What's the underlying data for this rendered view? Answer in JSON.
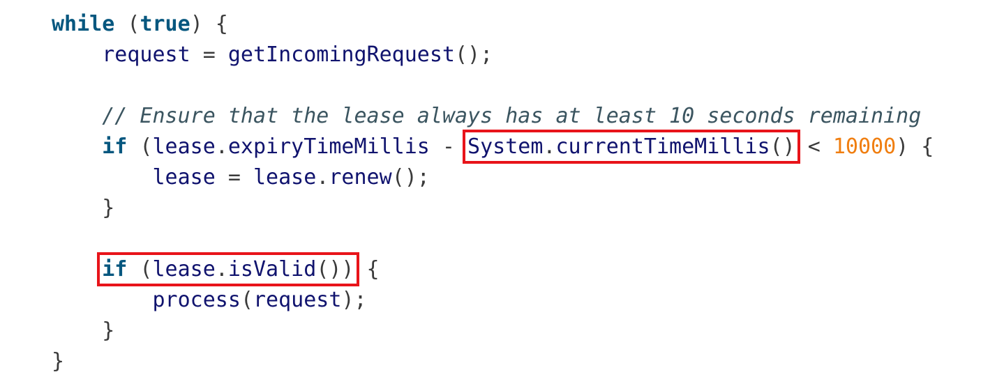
{
  "code": {
    "line1": {
      "kw_while": "while",
      "open_paren": " (",
      "kw_true": "true",
      "close": ") {"
    },
    "line2": {
      "indent": "    ",
      "var": "request",
      "eq": " = ",
      "call": "getIncomingRequest",
      "end": "();"
    },
    "line3": {},
    "line4": {
      "indent": "    ",
      "comment": "// Ensure that the lease always has at least 10 seconds remaining"
    },
    "line5": {
      "indent": "    ",
      "kw_if": "if",
      "paren": " (",
      "obj": "lease",
      "dot": ".",
      "field": "expiryTimeMillis",
      "minus": " - ",
      "hl_class": "System",
      "hl_dot": ".",
      "hl_method": "currentTimeMillis",
      "hl_parens": "()",
      "lt": " < ",
      "number": "10000",
      "close": ") {"
    },
    "line6": {
      "indent": "        ",
      "var": "lease",
      "eq": " = ",
      "obj": "lease",
      "dot": ".",
      "method": "renew",
      "end": "();"
    },
    "line7": {
      "indent": "    ",
      "brace": "}"
    },
    "line8": {},
    "line9": {
      "indent": "    ",
      "kw_if": "if",
      "paren": " (",
      "obj": "lease",
      "dot": ".",
      "method": "isValid",
      "parens": "())",
      "brace": " {"
    },
    "line10": {
      "indent": "        ",
      "call": "process",
      "open": "(",
      "arg": "request",
      "end": ");"
    },
    "line11": {
      "indent": "    ",
      "brace": "}"
    },
    "line12": {
      "brace": "}"
    }
  },
  "colors": {
    "keyword": "#06577f",
    "identifier": "#10136e",
    "punctuation": "#3a3a3a",
    "number": "#f07e10",
    "comment": "#3b5560",
    "highlight_box": "#e8141a"
  }
}
